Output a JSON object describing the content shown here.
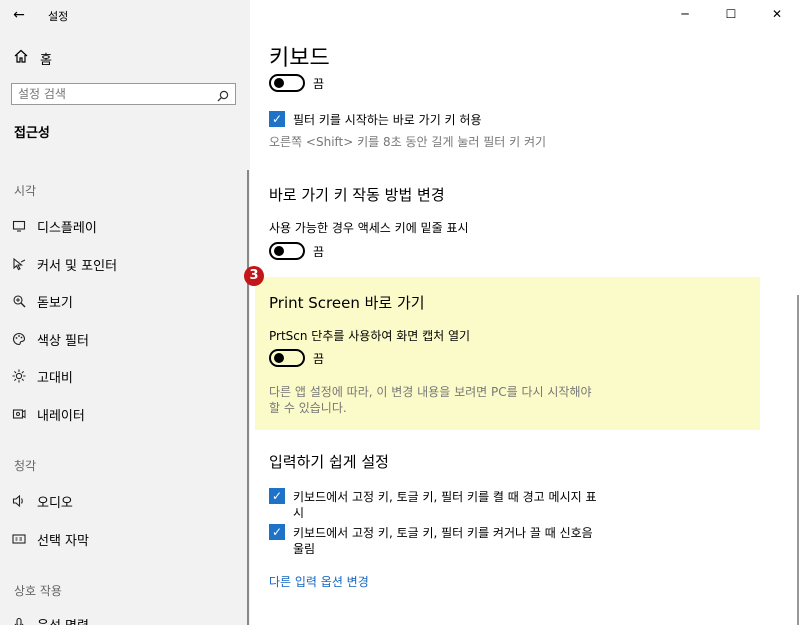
{
  "window": {
    "title": "설정",
    "back": "←",
    "minimize": "─",
    "maximize": "☐",
    "close": "✕"
  },
  "sidebar": {
    "home": "홈",
    "search_placeholder": "설정 검색",
    "section": "접근성",
    "categories": {
      "vision": "시각",
      "hearing": "청각",
      "interaction": "상호 작용"
    },
    "items": [
      {
        "label": "디스플레이",
        "icon": "monitor-icon"
      },
      {
        "label": "커서 및 포인터",
        "icon": "cursor-icon"
      },
      {
        "label": "돋보기",
        "icon": "magnifier-icon"
      },
      {
        "label": "색상 필터",
        "icon": "palette-icon"
      },
      {
        "label": "고대비",
        "icon": "contrast-icon"
      },
      {
        "label": "내레이터",
        "icon": "narrator-icon"
      },
      {
        "label": "오디오",
        "icon": "speaker-icon"
      },
      {
        "label": "선택 자막",
        "icon": "caption-icon"
      },
      {
        "label": "음성 명령",
        "icon": "voice-icon"
      }
    ]
  },
  "main": {
    "title": "키보드",
    "toggle_off": "끔",
    "filter_shortcut": "필터 키를 시작하는 바로 가기 키 허용",
    "filter_hint": "오른쪽 <Shift> 키를 8초 동안 길게 눌러 필터 키 켜기",
    "shortcut_heading": "바로 가기 키 작동 방법 변경",
    "underline_label": "사용 가능한 경우 액세스 키에 밑줄 표시",
    "badge": "3",
    "printscreen_heading": "Print Screen 바로 가기",
    "printscreen_label": "PrtScn 단추를 사용하여 화면 캡처 열기",
    "printscreen_note_1": "다른 앱 설정에 따라, 이 변경 내용을 보려면 PC를 다시 시작해야",
    "printscreen_note_2": "할 수 있습니다.",
    "typing_heading": "입력하기 쉽게 설정",
    "warn_1": "키보드에서 고정 키, 토글 키, 필터 키를 켤 때 경고 메시지 표",
    "warn_2": "시",
    "sound_1": "키보드에서 고정 키, 토글 키, 필터 키를 켜거나 끌 때 신호음",
    "sound_2": "울림",
    "more_link": "다른 입력 옵션 변경"
  }
}
